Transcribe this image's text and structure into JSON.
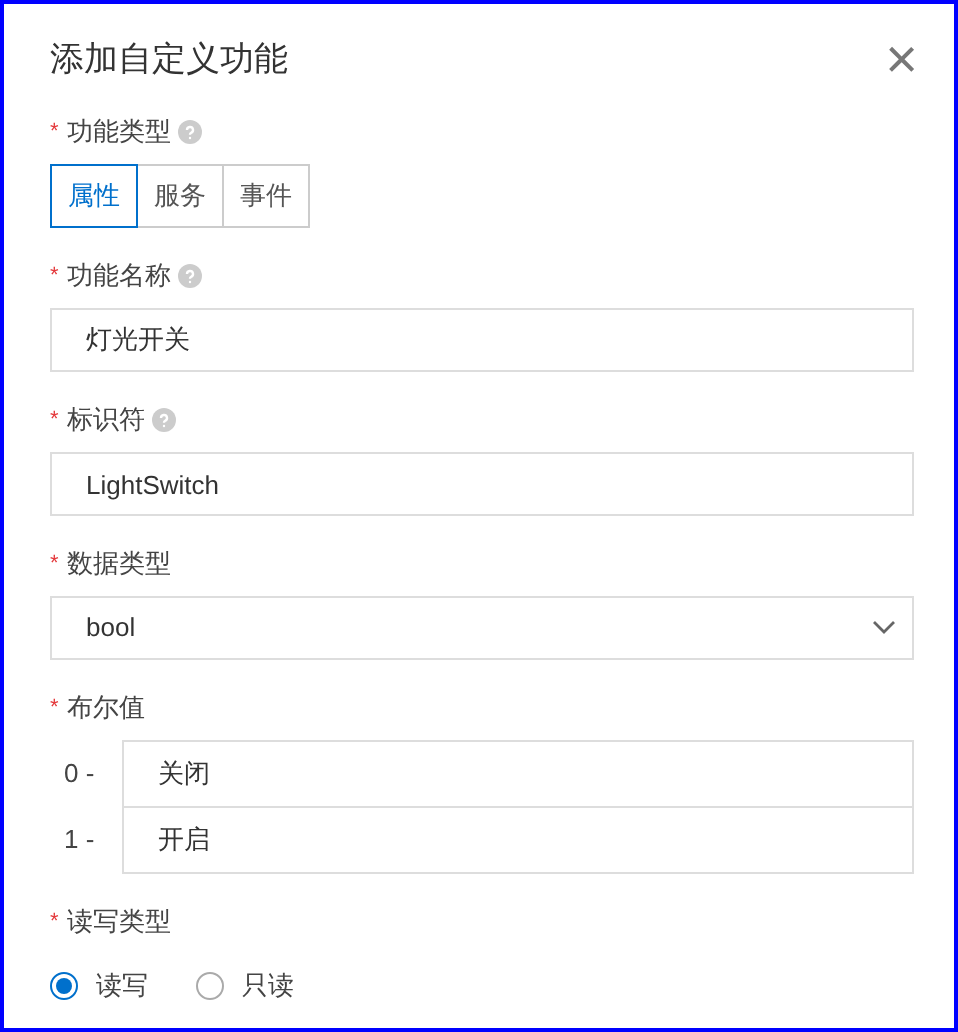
{
  "dialog": {
    "title": "添加自定义功能",
    "close": "×"
  },
  "fields": [
    {
      "kind": "segmented",
      "label": "功能类型",
      "marker": "*",
      "help": true,
      "options": [
        {
          "label": "属性",
          "selected": true
        },
        {
          "label": "服务",
          "selected": false
        },
        {
          "label": "事件",
          "selected": false
        }
      ]
    },
    {
      "kind": "text",
      "label": "功能名称",
      "marker": "*",
      "help": true,
      "value": "灯光开关"
    },
    {
      "kind": "text",
      "label": "标识符",
      "marker": "*",
      "help": true,
      "value": "LightSwitch"
    },
    {
      "kind": "select",
      "label": "数据类型",
      "marker": "*",
      "help": false,
      "value": "bool"
    },
    {
      "kind": "pairs",
      "label": "布尔值",
      "marker": "*",
      "help": false,
      "rows": [
        {
          "key": "0 -",
          "value": "关闭"
        },
        {
          "key": "1 -",
          "value": "开启"
        }
      ]
    },
    {
      "kind": "radio",
      "label": "读写类型",
      "marker": "*",
      "help": false,
      "options": [
        {
          "label": "读写",
          "selected": true
        },
        {
          "label": "只读",
          "selected": false
        }
      ]
    }
  ]
}
